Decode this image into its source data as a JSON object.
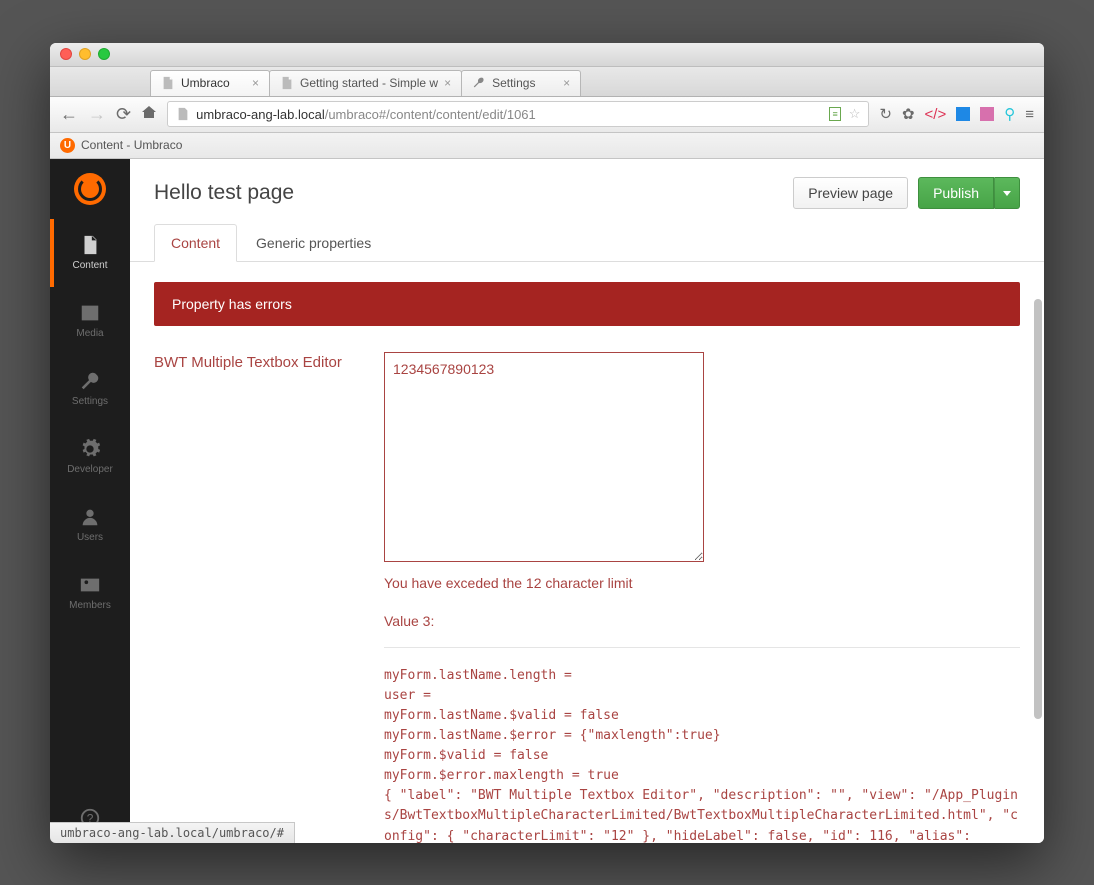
{
  "window": {
    "tabs": [
      {
        "title": "Umbraco",
        "active": true
      },
      {
        "title": "Getting started - Simple w",
        "active": false
      },
      {
        "title": "Settings",
        "active": false
      }
    ],
    "url_host": "umbraco-ang-lab.local",
    "url_path": "/umbraco#/content/content/edit/1061",
    "bookmark": "Content - Umbraco",
    "status_url": "umbraco-ang-lab.local/umbraco/#"
  },
  "sidebar": {
    "items": [
      {
        "label": "Content",
        "active": true
      },
      {
        "label": "Media"
      },
      {
        "label": "Settings"
      },
      {
        "label": "Developer"
      },
      {
        "label": "Users"
      },
      {
        "label": "Members"
      }
    ],
    "help_label": "Help"
  },
  "page": {
    "title": "Hello test page",
    "preview_label": "Preview page",
    "publish_label": "Publish",
    "tabs": [
      {
        "label": "Content",
        "active": true
      },
      {
        "label": "Generic properties"
      }
    ],
    "alert": "Property has errors",
    "property_label": "BWT Multiple Textbox Editor",
    "textarea_value": "1234567890123",
    "char_limit_error": "You have exceded the 12 character limit",
    "value_count_label": "Value 3:",
    "debug_lines": [
      "myForm.lastName.length =",
      "user =",
      "myForm.lastName.$valid = false",
      "myForm.lastName.$error = {\"maxlength\":true}",
      "myForm.$valid = false",
      "myForm.$error.maxlength = true",
      "{ \"label\": \"BWT Multiple Textbox Editor\", \"description\": \"\", \"view\": \"/App_Plugins/BwtTextboxMultipleCharacterLimited/BwtTextboxMultipleCharacterLimited.html\", \"config\": { \"characterLimit\": \"12\" }, \"hideLabel\": false, \"id\": 116, \"alias\":"
    ]
  },
  "colors": {
    "error": "#a94442",
    "alert_bg": "#a52421",
    "accent": "#ff6a00",
    "success": "#5cb85c"
  }
}
